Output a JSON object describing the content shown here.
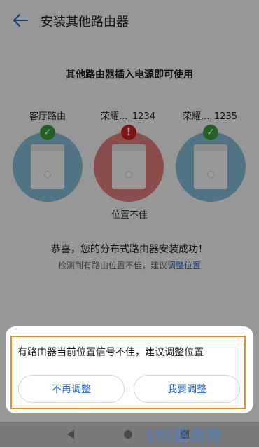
{
  "header": {
    "title": "安装其他路由器",
    "back_icon": "arrow-left-icon"
  },
  "subtitle": "其他路由器插入电源即可使用",
  "routers": [
    {
      "label": "客厅路由",
      "status": "ok"
    },
    {
      "label": "荣耀..._1234",
      "status": "error",
      "note": "位置不佳"
    },
    {
      "label": "荣耀..._1235",
      "status": "ok"
    }
  ],
  "success_message": "恭喜，您的分布式路由器安装成功！",
  "detect_message": {
    "text": "检测到有路由位置不佳，建议",
    "link": "调整位置"
  },
  "sheet": {
    "message": "有路由器当前位置信号不佳，建议调整位置",
    "cancel_label": "不再调整",
    "confirm_label": "我要调整"
  },
  "watermark": "192路由网",
  "colors": {
    "accent": "#2060c8",
    "ok": "#3a9d3a",
    "error": "#cc2222",
    "highlight": "#f08c1a"
  }
}
